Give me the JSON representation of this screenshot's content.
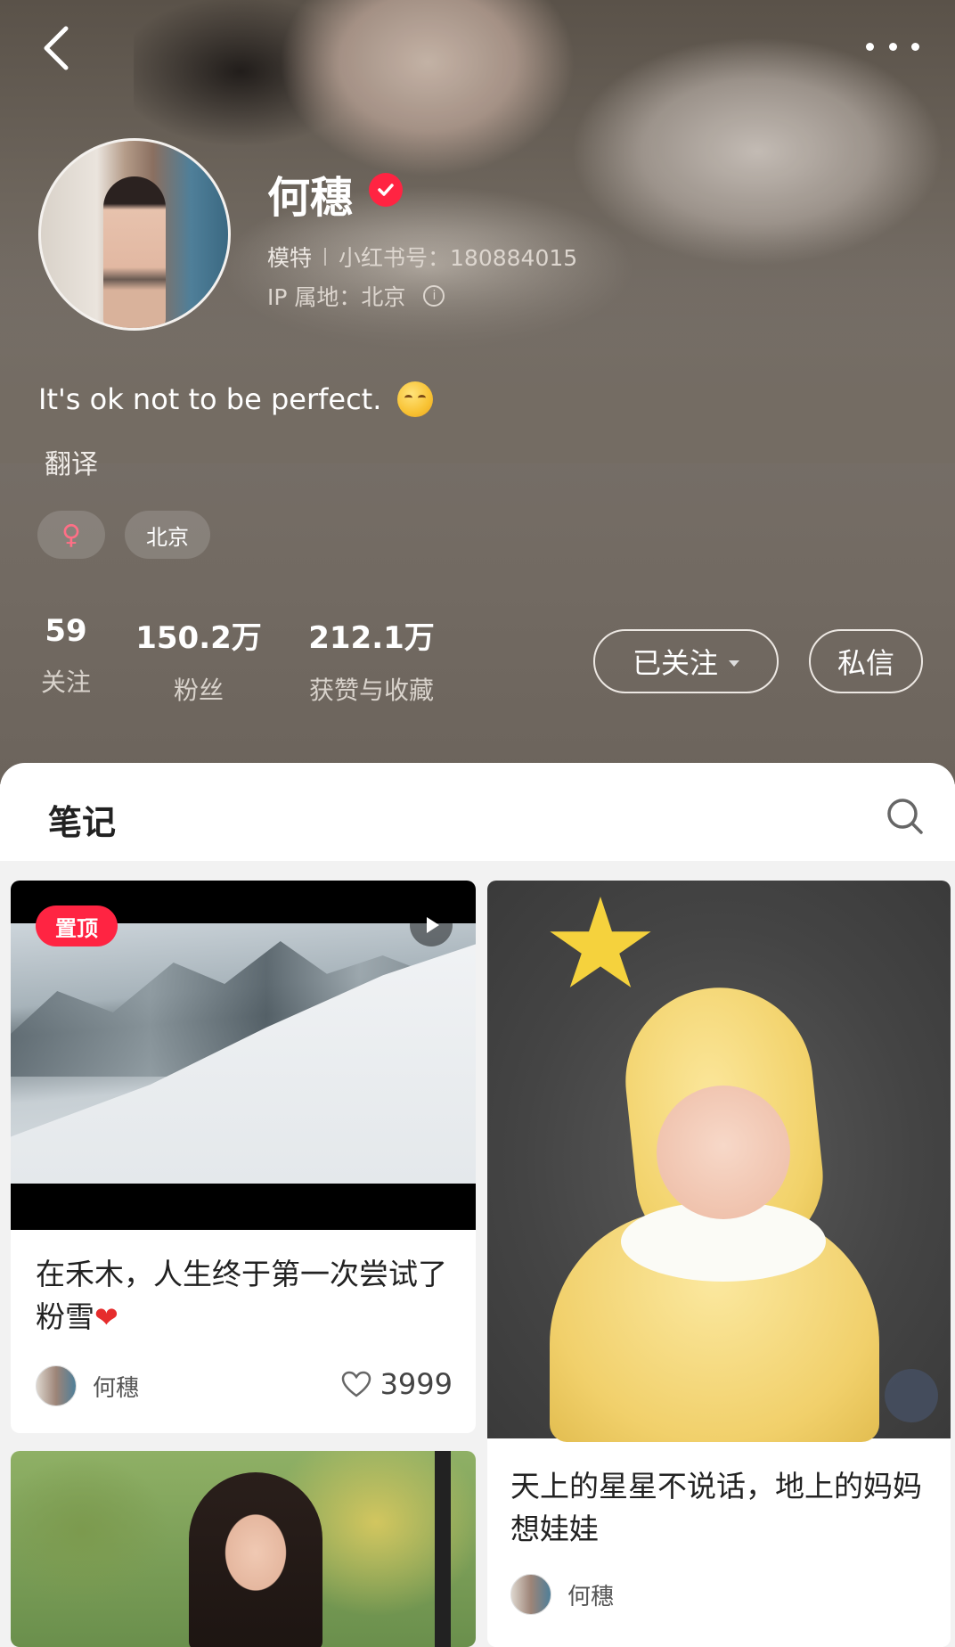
{
  "profile": {
    "name": "何穗",
    "occupation": "模特",
    "id_label": "小红书号：180884015",
    "ip_label": "IP 属地：北京",
    "bio": "It's ok not to be perfect.",
    "translate": "翻译",
    "tags": {
      "gender_symbol": "♀",
      "city": "北京"
    },
    "stats": [
      {
        "value": "59",
        "label": "关注"
      },
      {
        "value": "150.2万",
        "label": "粉丝"
      },
      {
        "value": "212.1万",
        "label": "获赞与收藏"
      }
    ],
    "follow_label": "已关注",
    "message_label": "私信"
  },
  "tabs": {
    "notes": "笔记"
  },
  "notes": [
    {
      "badge": "置顶",
      "title": "在禾木，人生终于第一次尝试了粉雪",
      "author": "何穗",
      "likes": "3999"
    },
    {
      "title": "天上的星星不说话，地上的妈妈想娃娃",
      "author": "何穗"
    }
  ],
  "colors": {
    "accent": "#ff2442",
    "header_bg": "#736b63"
  }
}
